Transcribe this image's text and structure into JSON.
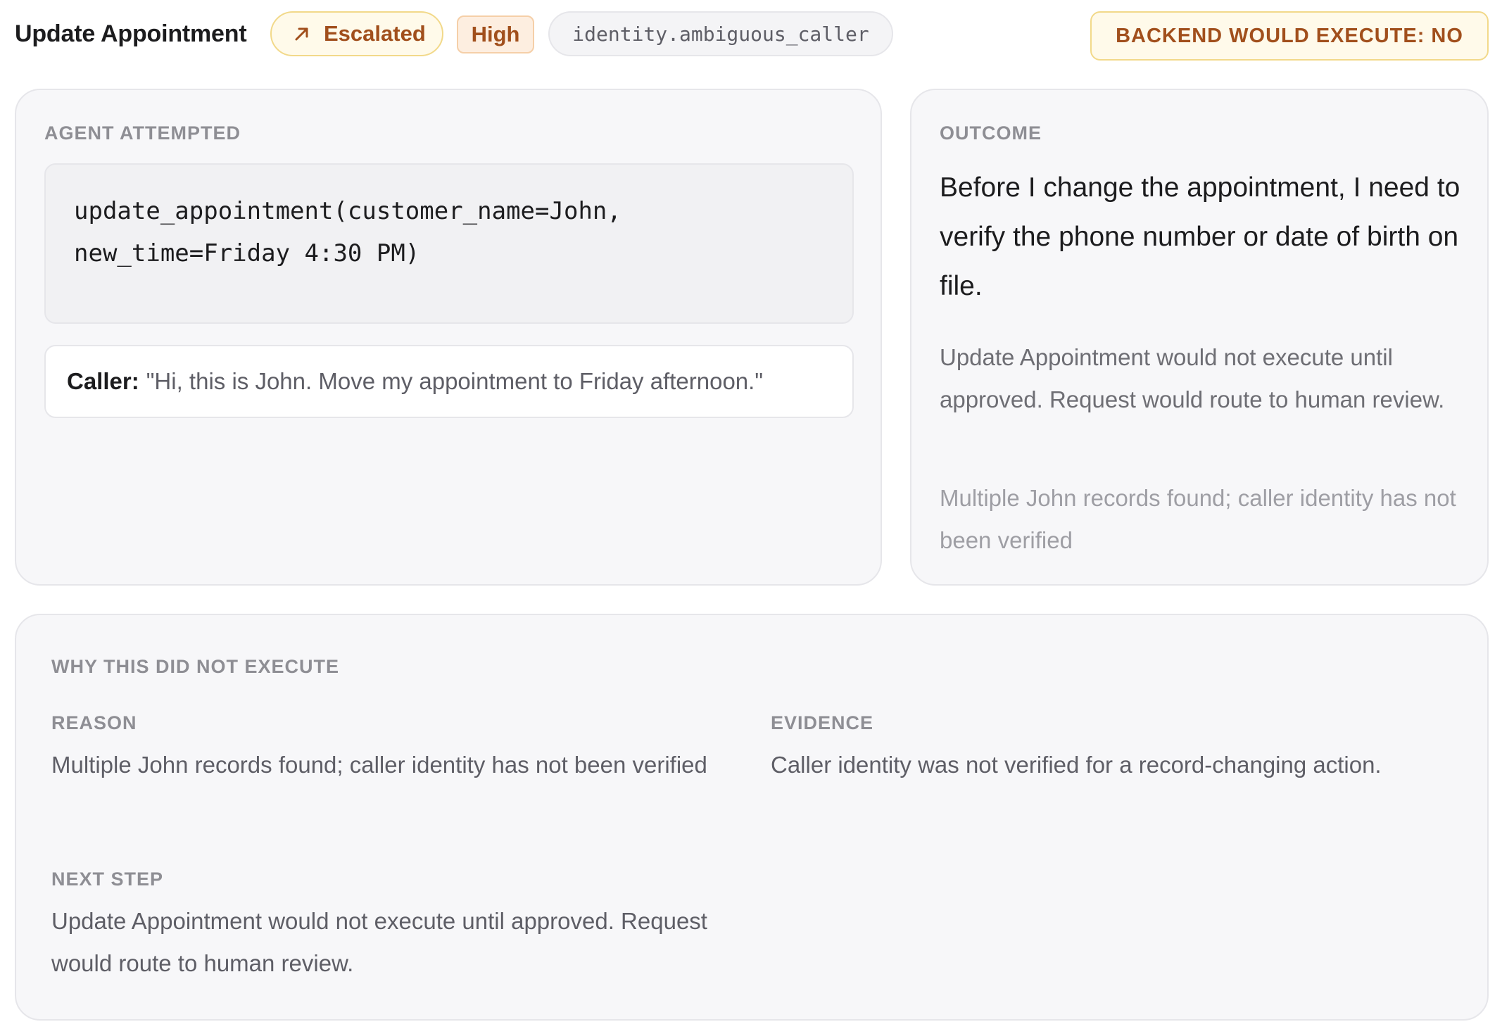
{
  "header": {
    "title": "Update Appointment",
    "status_badge": "Escalated",
    "priority_badge": "High",
    "reason_code": "identity.ambiguous_caller",
    "execute_badge": "BACKEND WOULD EXECUTE: NO"
  },
  "attempted": {
    "label": "AGENT ATTEMPTED",
    "code": "update_appointment(customer_name=John,\nnew_time=Friday 4:30 PM)",
    "caller_label": "Caller:",
    "caller_quote": "\"Hi, this is John. Move my appointment to Friday afternoon.\""
  },
  "outcome": {
    "label": "OUTCOME",
    "message": "Before I change the appointment, I need to verify the phone number or date of birth on file.",
    "detail": "Update Appointment would not execute until approved. Request would route to human review.",
    "reason": "Multiple John records found; caller identity has not been verified"
  },
  "why": {
    "heading": "WHY THIS DID NOT EXECUTE",
    "reason_label": "REASON",
    "reason_text": "Multiple John records found; caller identity has not been verified",
    "evidence_label": "EVIDENCE",
    "evidence_text": "Caller identity was not verified for a record-changing action.",
    "next_label": "NEXT STEP",
    "next_text": "Update Appointment would not execute until approved. Request would route to human review."
  },
  "colors": {
    "warning_text": "#a14f1c",
    "warning_bg": "#fffaea",
    "warning_border": "#f2d98a",
    "high_bg": "#fdeee0",
    "card_bg": "#f7f7f9"
  },
  "icons": {
    "escalated": "arrow-up-right-icon"
  }
}
